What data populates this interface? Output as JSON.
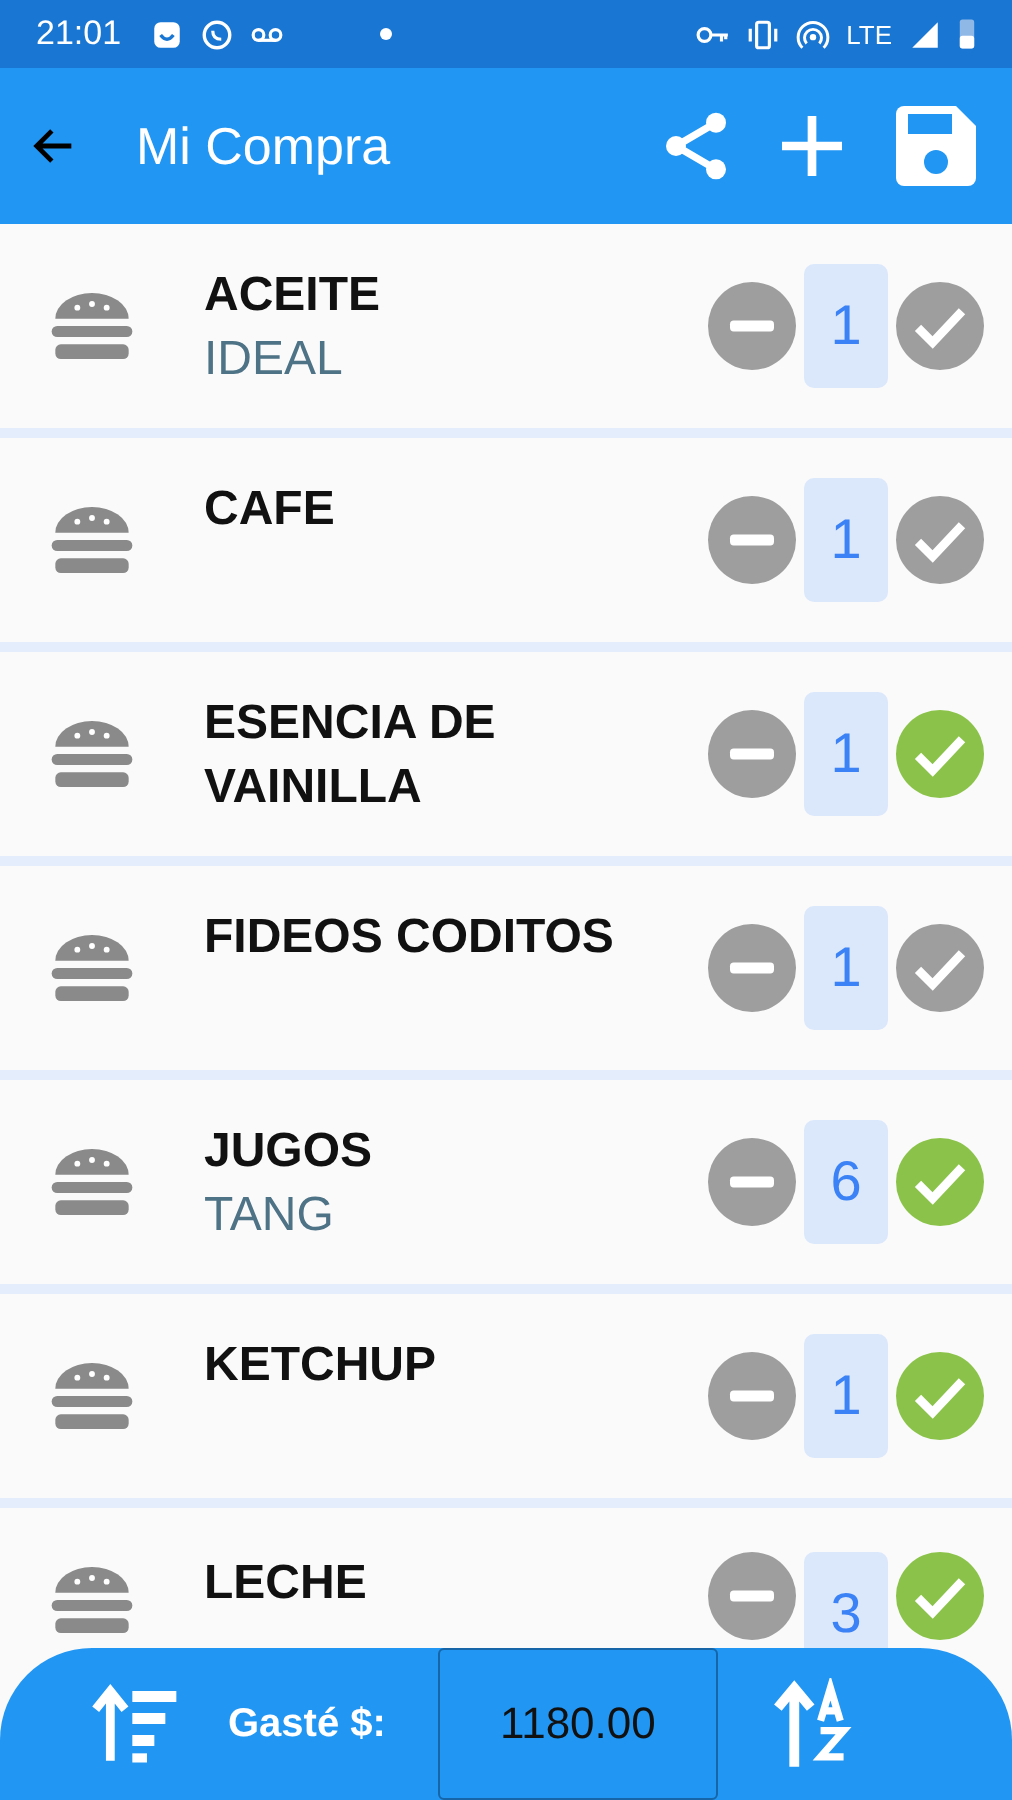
{
  "status_bar": {
    "time": "21:01",
    "network": "LTE"
  },
  "app_bar": {
    "title": "Mi Compra"
  },
  "items": [
    {
      "name": "ACEITE",
      "brand": "IDEAL",
      "quantity": "1",
      "checked": false
    },
    {
      "name": "CAFE",
      "quantity": "1",
      "checked": false
    },
    {
      "name": "ESENCIA DE VAINILLA",
      "quantity": "1",
      "checked": true
    },
    {
      "name": "FIDEOS CODITOS",
      "quantity": "1",
      "checked": false
    },
    {
      "name": "JUGOS",
      "brand": "TANG",
      "quantity": "6",
      "checked": true
    },
    {
      "name": "KETCHUP",
      "quantity": "1",
      "checked": true
    },
    {
      "name": "LECHE",
      "quantity": "3",
      "checked": true
    }
  ],
  "footer": {
    "label": "Gasté $:",
    "total": "1180.00"
  }
}
